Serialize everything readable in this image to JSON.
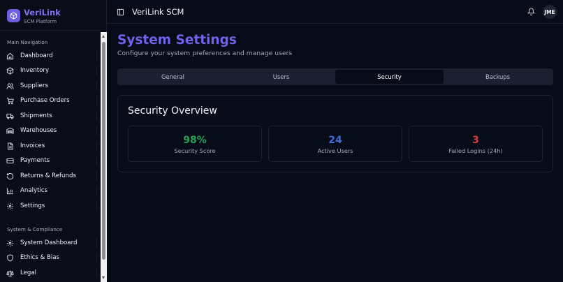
{
  "brand": {
    "name": "VeriLink",
    "subtitle": "SCM Platform"
  },
  "sidebar": {
    "section_main": "Main Navigation",
    "items": [
      {
        "label": "Dashboard",
        "icon": "home-icon"
      },
      {
        "label": "Inventory",
        "icon": "package-icon"
      },
      {
        "label": "Suppliers",
        "icon": "users-icon"
      },
      {
        "label": "Purchase Orders",
        "icon": "cart-icon"
      },
      {
        "label": "Shipments",
        "icon": "truck-icon"
      },
      {
        "label": "Warehouses",
        "icon": "warehouse-icon"
      },
      {
        "label": "Invoices",
        "icon": "file-icon"
      },
      {
        "label": "Payments",
        "icon": "credit-card-icon"
      },
      {
        "label": "Returns & Refunds",
        "icon": "rotate-ccw-icon"
      },
      {
        "label": "Analytics",
        "icon": "bar-chart-icon"
      },
      {
        "label": "Settings",
        "icon": "gear-icon"
      }
    ],
    "section_system": "System & Compliance",
    "system_items": [
      {
        "label": "System Dashboard",
        "icon": "gear-icon"
      },
      {
        "label": "Ethics & Bias",
        "icon": "shield-icon"
      },
      {
        "label": "Legal",
        "icon": "scale-icon"
      }
    ]
  },
  "header": {
    "title": "VeriLink SCM",
    "avatar_initials": "JME"
  },
  "main": {
    "title": "System Settings",
    "subtitle": "Configure your system preferences and manage users",
    "tabs": [
      {
        "label": "General"
      },
      {
        "label": "Users"
      },
      {
        "label": "Security"
      },
      {
        "label": "Backups"
      }
    ],
    "active_tab": "Security",
    "overview": {
      "title": "Security Overview",
      "stats": [
        {
          "value": "98%",
          "label": "Security Score",
          "color": "#22a35a"
        },
        {
          "value": "24",
          "label": "Active Users",
          "color": "#3b6fe0"
        },
        {
          "value": "3",
          "label": "Failed Logins (24h)",
          "color": "#dc3b3b"
        }
      ]
    }
  },
  "colors": {
    "accent": "#6f63ee",
    "background": "#070b17"
  }
}
